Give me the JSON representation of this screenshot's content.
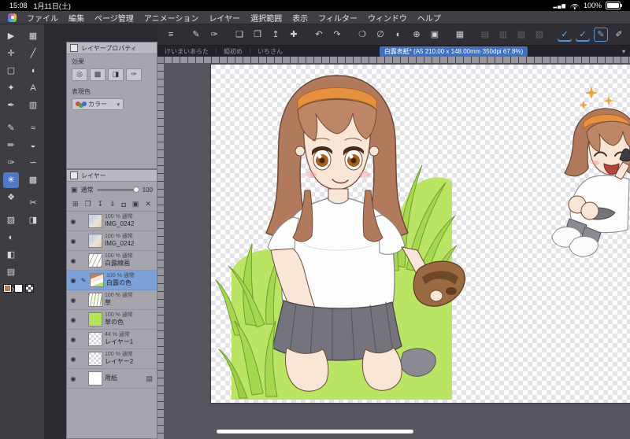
{
  "status_bar": {
    "time": "15:08",
    "date": "1月11日(土)",
    "battery_percent": "100%",
    "signal_glyph": "▂▄▆"
  },
  "menu_bar": {
    "items": [
      "ファイル",
      "編集",
      "ページ管理",
      "アニメーション",
      "レイヤー",
      "選択範囲",
      "表示",
      "フィルター",
      "ウィンドウ",
      "ヘルプ"
    ]
  },
  "toolbar": {
    "icons": [
      {
        "name": "menu-icon",
        "glyph": "≡"
      },
      {
        "name": "current-tool-icon",
        "glyph": "✎"
      },
      {
        "name": "current-subtool-icon",
        "glyph": "✑"
      },
      {
        "name": "new-canvas-icon",
        "glyph": "❏"
      },
      {
        "name": "open-file-icon",
        "glyph": "❐"
      },
      {
        "name": "share-icon",
        "glyph": "↥"
      },
      {
        "name": "import-icon",
        "glyph": "✚"
      },
      {
        "name": "undo-icon",
        "glyph": "↶"
      },
      {
        "name": "redo-icon",
        "glyph": "↷"
      },
      {
        "name": "select-area-icon",
        "glyph": "❍"
      },
      {
        "name": "deselect-icon",
        "glyph": "∅"
      },
      {
        "name": "invert-selection-icon",
        "glyph": "◐"
      },
      {
        "name": "expand-selection-icon",
        "glyph": "⊕"
      },
      {
        "name": "selection-menu-icon",
        "glyph": "▣"
      },
      {
        "name": "crop-icon",
        "glyph": "▦"
      },
      {
        "name": "grid-icon",
        "glyph": "▤"
      },
      {
        "name": "guide-icon",
        "glyph": "▥"
      },
      {
        "name": "material-icon",
        "glyph": "▧"
      },
      {
        "name": "snap-icon",
        "glyph": "▨"
      },
      {
        "name": "pen-mode-icon",
        "glyph": "✓"
      },
      {
        "name": "stabilizer-icon",
        "glyph": "✓"
      },
      {
        "name": "edit-line-icon",
        "glyph": "✎"
      },
      {
        "name": "gesture-icon",
        "glyph": "✐"
      }
    ]
  },
  "tab_bar": {
    "tabs": [
      "けいまいあらた",
      "姫初め",
      "いちさん"
    ],
    "active_tab": "白露表紙* (A5 210.00 x 148.00mm 350dpi 67.8%)"
  },
  "tool_palette": {
    "column1": [
      {
        "name": "operation-tool",
        "glyph": "▶"
      },
      {
        "name": "move-layer-tool",
        "glyph": "✛"
      },
      {
        "name": "selection-tool",
        "glyph": "▢"
      },
      {
        "name": "auto-select-tool",
        "glyph": "✦"
      },
      {
        "name": "eyedropper-tool",
        "glyph": "✒"
      },
      {
        "name": "pen-tool",
        "glyph": "✎"
      },
      {
        "name": "pencil-tool",
        "glyph": "✏"
      },
      {
        "name": "brush-tool",
        "glyph": "✑"
      },
      {
        "name": "airbrush-tool",
        "glyph": "✳"
      },
      {
        "name": "decoration-tool",
        "glyph": "❖"
      },
      {
        "name": "eraser-tool",
        "glyph": "▨"
      },
      {
        "name": "blend-tool",
        "glyph": "◐"
      },
      {
        "name": "fill-tool",
        "glyph": "◧"
      },
      {
        "name": "gradient-tool",
        "glyph": "▤"
      },
      {
        "name": "figure-tool",
        "glyph": "◇"
      }
    ],
    "column2": [
      {
        "name": "frame-tool",
        "glyph": "▦"
      },
      {
        "name": "ruler-tool",
        "glyph": "╱"
      },
      {
        "name": "balloon-tool",
        "glyph": "◖"
      },
      {
        "name": "text-tool",
        "glyph": "A"
      },
      {
        "name": "story-tool",
        "glyph": "▥"
      },
      {
        "name": "lasso-fill-tool",
        "glyph": "≈"
      },
      {
        "name": "mix-color-tool",
        "glyph": "◒"
      },
      {
        "name": "liquify-tool",
        "glyph": "∽"
      },
      {
        "name": "mesh-tool",
        "glyph": "▩"
      },
      {
        "name": "snip-tool",
        "glyph": "✂"
      },
      {
        "name": "lighttable-tool",
        "glyph": "◨"
      }
    ],
    "main_color": "#bd7a50",
    "sub_color": "#ffffff"
  },
  "layer_property_panel": {
    "title": "レイヤープロパティ",
    "effect_label": "効果",
    "expression_label": "表現色",
    "color_mode_label": "カラー",
    "effect_buttons": [
      {
        "name": "border-effect-button",
        "glyph": "◎"
      },
      {
        "name": "tone-button",
        "glyph": "▩"
      },
      {
        "name": "layer-color-button",
        "glyph": "◨"
      },
      {
        "name": "extract-line-button",
        "glyph": "✑"
      }
    ]
  },
  "layer_panel": {
    "title": "レイヤー",
    "panel_icon": "▣",
    "blend_mode": "通常",
    "opacity_value": "100",
    "tool_buttons": [
      {
        "name": "new-layer-button",
        "glyph": "⊞"
      },
      {
        "name": "new-folder-button",
        "glyph": "❐"
      },
      {
        "name": "transfer-down-button",
        "glyph": "↧"
      },
      {
        "name": "merge-down-button",
        "glyph": "⇓"
      },
      {
        "name": "create-mask-button",
        "glyph": "◘"
      },
      {
        "name": "layer-settings-button",
        "glyph": "▣"
      },
      {
        "name": "delete-layer-button",
        "glyph": "✕"
      }
    ],
    "layers": [
      {
        "opacity": "100 %",
        "mode": "通常",
        "name": "IMG_0242"
      },
      {
        "opacity": "100 %",
        "mode": "通常",
        "name": "IMG_0242"
      },
      {
        "opacity": "100 %",
        "mode": "通常",
        "name": "白露線画"
      },
      {
        "opacity": "100 %",
        "mode": "通常",
        "name": "白露の色"
      },
      {
        "opacity": "100 %",
        "mode": "通常",
        "name": "草"
      },
      {
        "opacity": "100 %",
        "mode": "通常",
        "name": "草の色"
      },
      {
        "opacity": "44 %",
        "mode": "通常",
        "name": "レイヤー1"
      },
      {
        "opacity": "100 %",
        "mode": "通常",
        "name": "レイヤー2"
      },
      {
        "name": "用紙"
      }
    ]
  },
  "ui": {
    "caret": "▾",
    "eye": "◉",
    "pencil": "✎",
    "paper_glyph": "▤"
  },
  "colors": {
    "accent_blue": "#4f94dd",
    "selected_layer": "#7ba1d8",
    "grass_green": "#b5e35e",
    "hair_brown": "#b27a5c"
  }
}
